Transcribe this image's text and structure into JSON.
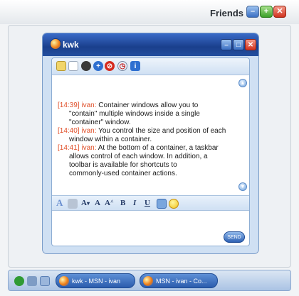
{
  "outer": {
    "title": "Friends"
  },
  "chat": {
    "title": "kwk",
    "messages": [
      {
        "time": "[14:39]",
        "nick": "ivan:",
        "lines": [
          "Container windows allow you to",
          "\"contain\" multiple windows inside a single",
          "\"container\" window."
        ]
      },
      {
        "time": "[14:40]",
        "nick": "ivan:",
        "lines": [
          "You control the size and position of each",
          "window within a container."
        ]
      },
      {
        "time": "[14:41]",
        "nick": "ivan:",
        "lines": [
          "At the bottom of a container, a taskbar",
          "allows control of each window.  In addition, a",
          "toolbar is available for shortcuts to",
          "commonly-used container actions."
        ]
      }
    ],
    "format_labels": {
      "font_smaller": "A",
      "font": "A",
      "font_larger": "A",
      "bold": "B",
      "italic": "I",
      "underline": "U"
    },
    "send_label": "SEND"
  },
  "taskbar": {
    "tasks": [
      {
        "label": "kwk - MSN - ivan"
      },
      {
        "label": "MSN - ivan - Co..."
      }
    ]
  },
  "colors": {
    "accent_blue": "#2b5cad",
    "nick_red": "#e0502a"
  }
}
